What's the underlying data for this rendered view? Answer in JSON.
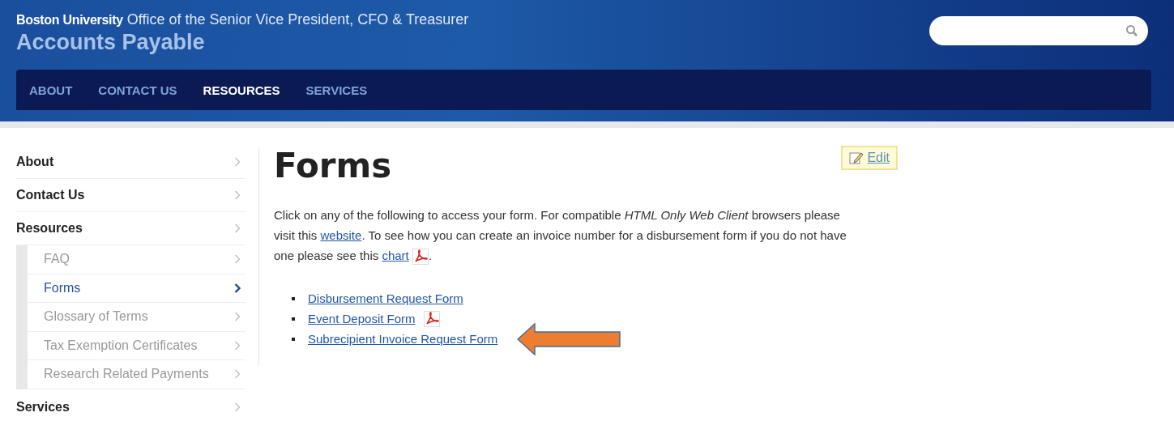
{
  "header": {
    "org": "Boston University",
    "office": "Office of the Senior Vice President, CFO & Treasurer",
    "site_title": "Accounts Payable"
  },
  "nav": [
    {
      "label": "ABOUT",
      "selected": false
    },
    {
      "label": "CONTACT US",
      "selected": false
    },
    {
      "label": "RESOURCES",
      "selected": true
    },
    {
      "label": "SERVICES",
      "selected": false
    }
  ],
  "sidebar": {
    "items": [
      {
        "label": "About",
        "selected": false
      },
      {
        "label": "Contact Us",
        "selected": false
      },
      {
        "label": "Resources",
        "selected": false,
        "children": [
          {
            "label": "FAQ",
            "selected": false
          },
          {
            "label": "Forms",
            "selected": true
          },
          {
            "label": "Glossary of Terms",
            "selected": false
          },
          {
            "label": "Tax Exemption Certificates",
            "selected": false
          },
          {
            "label": "Research Related Payments",
            "selected": false
          }
        ]
      },
      {
        "label": "Services",
        "selected": false
      }
    ]
  },
  "page": {
    "title": "Forms",
    "edit": "Edit",
    "intro": [
      {
        "kind": "text",
        "text": "Click on any of the following to access your form. For compatible *HTML Only Web Client* browsers please visit this "
      },
      {
        "kind": "link",
        "text": "website"
      },
      {
        "kind": "text",
        "text": ". To see how you can create an invoice number for a disbursement form if you do not have one please see this "
      },
      {
        "kind": "link",
        "text": "chart"
      },
      {
        "kind": "pdf"
      },
      {
        "kind": "text",
        "text": "."
      }
    ],
    "forms": [
      {
        "label": "Disbursement Request Form",
        "pdf": false,
        "highlighted": false
      },
      {
        "label": "Event Deposit Form",
        "pdf": true,
        "highlighted": false
      },
      {
        "label": "Subrecipient Invoice Request Form",
        "pdf": false,
        "highlighted": true
      }
    ]
  }
}
